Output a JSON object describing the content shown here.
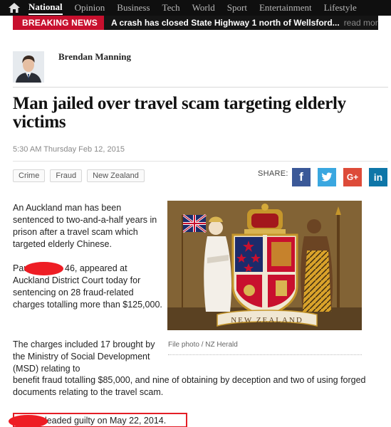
{
  "nav": {
    "items": [
      "National",
      "Opinion",
      "Business",
      "Tech",
      "World",
      "Sport",
      "Entertainment",
      "Lifestyle"
    ],
    "active": "National",
    "home_icon": "home-icon"
  },
  "breaking": {
    "label": "BREAKING NEWS",
    "text": "A crash has closed State Highway 1 north of Wellsford...",
    "more": "read more"
  },
  "author": {
    "name": "Brendan Manning"
  },
  "article": {
    "headline": "Man jailed over travel scam targeting elderly victims",
    "timestamp": "5:30 AM Thursday Feb 12, 2015",
    "tags": [
      "Crime",
      "Fraud",
      "New Zealand"
    ],
    "share_label": "SHARE:",
    "share_icons": [
      "facebook-icon",
      "twitter-icon",
      "google-plus-icon",
      "linkedin-icon"
    ],
    "share_glyphs": {
      "facebook": "f",
      "google_plus": "G+",
      "linkedin": "in"
    },
    "paragraphs": [
      "An Auckland man has been sentenced to two-and-a-half years in prison after a travel scam which targeted elderly Chinese.",
      "Paul",
      "46, appeared at Auckland District Court today for sentencing on 28 fraud-related charges totalling more than $125,000.",
      "The charges included 17 brought by the Ministry of Social Development (MSD) relating to",
      "benefit fraud totalling $85,000, and nine of obtaining by deception and two of using forged documents relating to the travel scam.",
      "pleaded guilty on May 22, 2014."
    ],
    "photo_caption": "File photo / NZ Herald",
    "photo_text": "NEW ZEALAND"
  },
  "colors": {
    "breaking_red": "#c8102e",
    "facebook": "#3b5998",
    "twitter": "#3aa7e0",
    "google_plus": "#dd4b39",
    "linkedin": "#0e76a8",
    "redaction": "#ee1d24"
  }
}
